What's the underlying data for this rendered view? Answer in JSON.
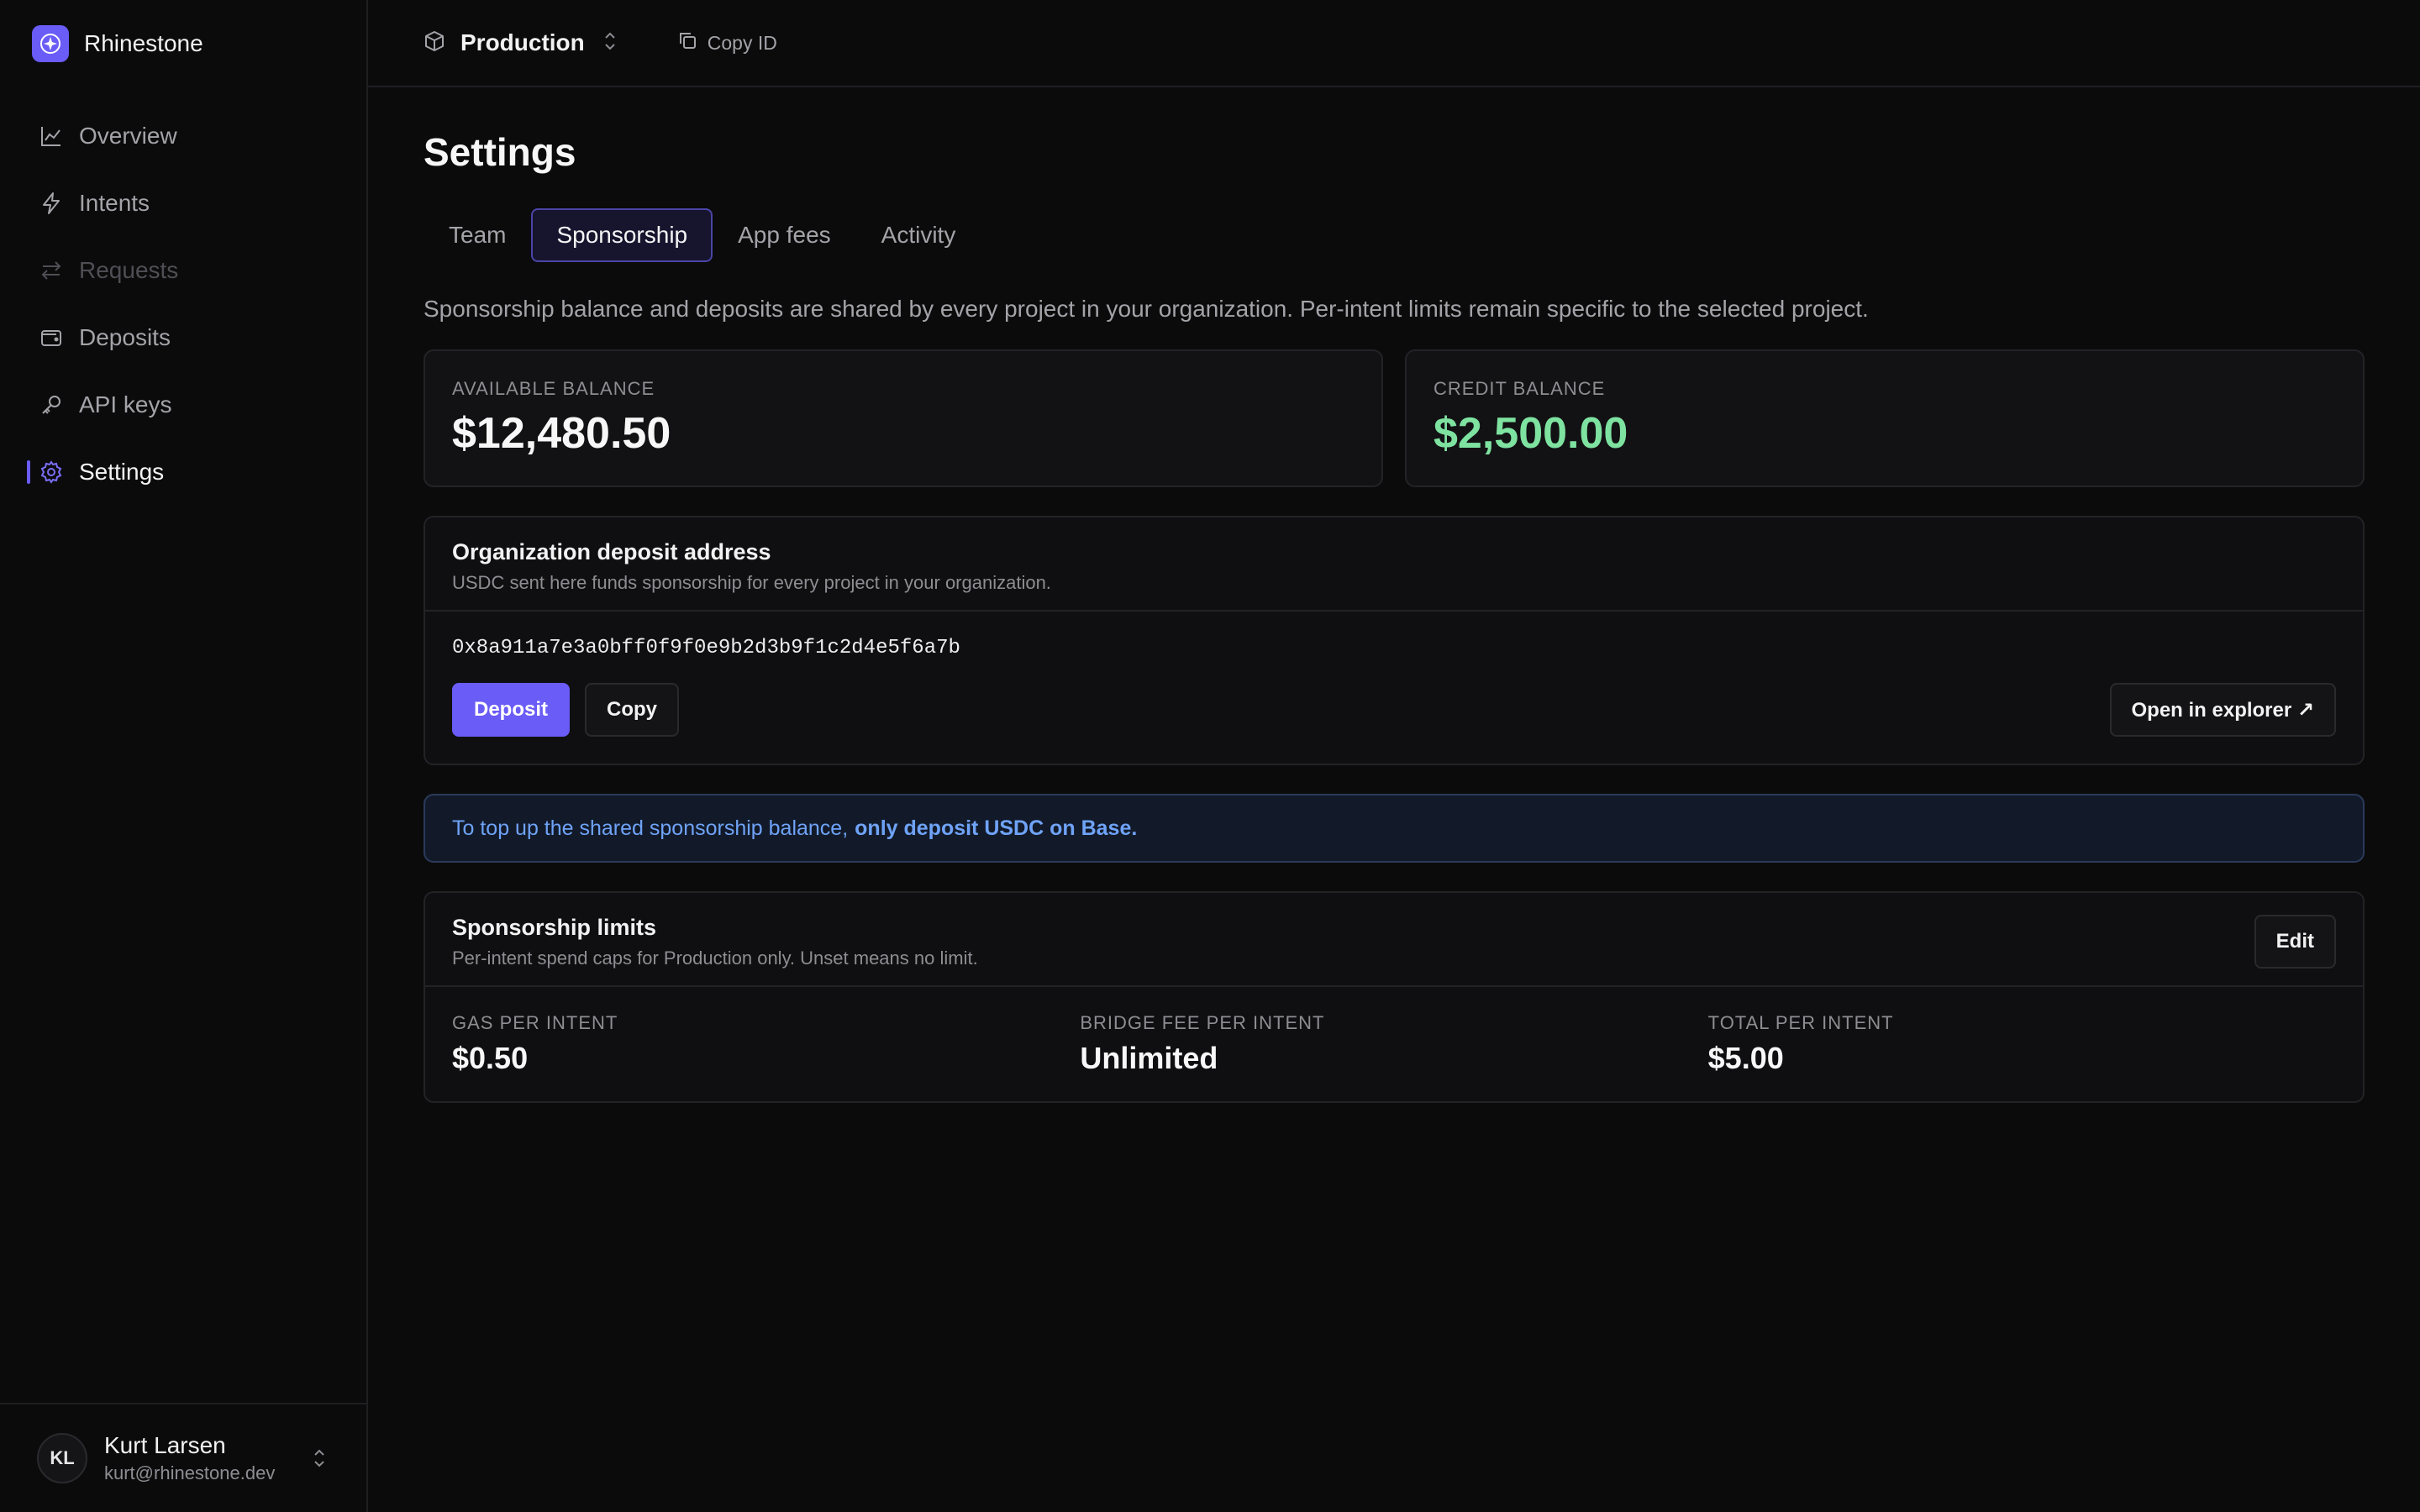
{
  "brand": {
    "name": "Rhinestone"
  },
  "sidebar": {
    "items": [
      {
        "label": "Overview",
        "icon": "chart-line-icon"
      },
      {
        "label": "Intents",
        "icon": "bolt-icon"
      },
      {
        "label": "Requests",
        "icon": "arrows-swap-icon"
      },
      {
        "label": "Deposits",
        "icon": "wallet-icon"
      },
      {
        "label": "API keys",
        "icon": "key-icon"
      },
      {
        "label": "Settings",
        "icon": "gear-icon"
      }
    ]
  },
  "user": {
    "initials": "KL",
    "name": "Kurt Larsen",
    "email": "kurt@rhinestone.dev"
  },
  "topbar": {
    "project": "Production",
    "copy_id": "Copy ID"
  },
  "page": {
    "title": "Settings"
  },
  "tabs": [
    "Team",
    "Sponsorship",
    "App fees",
    "Activity"
  ],
  "description": "Sponsorship balance and deposits are shared by every project in your organization. Per-intent limits remain specific to the selected project.",
  "balances": {
    "available": {
      "label": "AVAILABLE BALANCE",
      "value": "$12,480.50"
    },
    "credit": {
      "label": "CREDIT BALANCE",
      "value": "$2,500.00"
    }
  },
  "deposit": {
    "title": "Organization deposit address",
    "subtitle": "USDC sent here funds sponsorship for every project in your organization.",
    "address": "0x8a911a7e3a0bff0f9f0e9b2d3b9f1c2d4e5f6a7b",
    "deposit_label": "Deposit",
    "copy_label": "Copy",
    "explorer_label": "Open in explorer ↗"
  },
  "notice": {
    "text": "To top up the shared sponsorship balance,",
    "emphasis": "only deposit USDC on Base."
  },
  "limits": {
    "title": "Sponsorship limits",
    "subtitle": "Per-intent spend caps for Production only. Unset means no limit.",
    "edit_label": "Edit",
    "items": [
      {
        "label": "GAS PER INTENT",
        "value": "$0.50"
      },
      {
        "label": "BRIDGE FEE PER INTENT",
        "value": "Unlimited"
      },
      {
        "label": "TOTAL PER INTENT",
        "value": "$5.00"
      }
    ]
  },
  "colors": {
    "accent": "#6a5cf6",
    "credit_green": "#7ee2a0",
    "notice_blue": "#6fa3f7"
  }
}
